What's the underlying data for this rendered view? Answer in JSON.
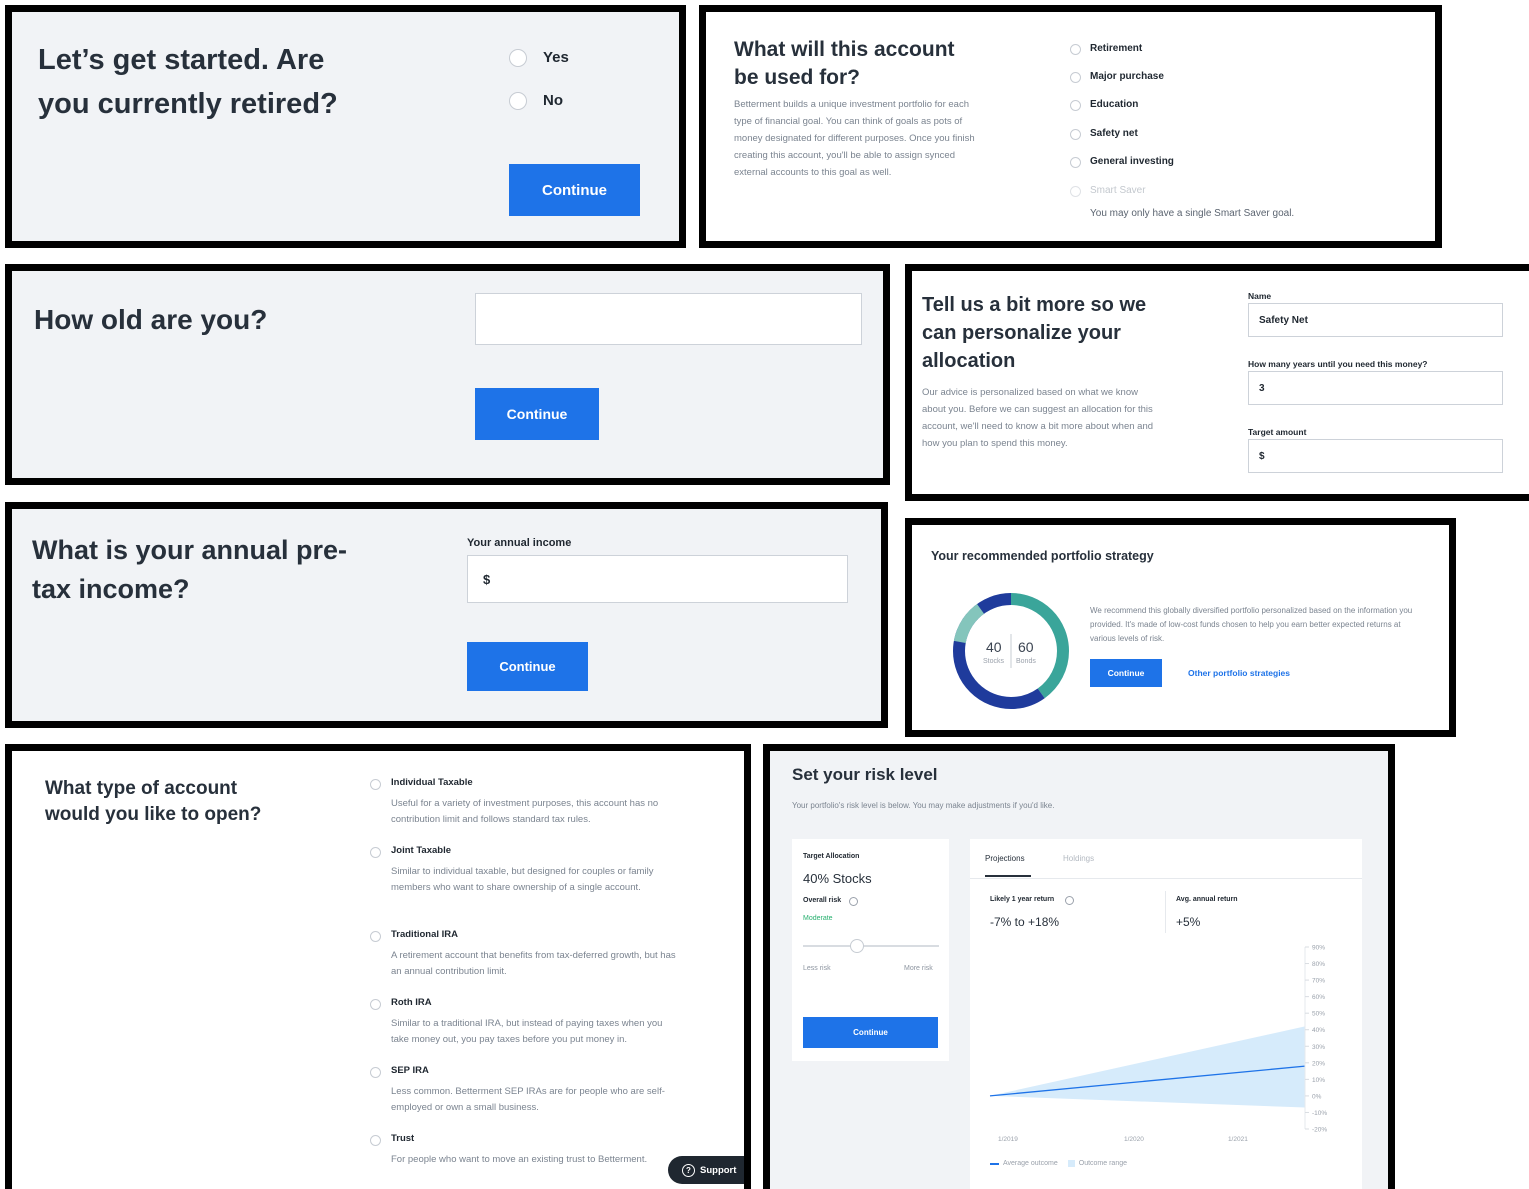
{
  "retired": {
    "title": "Let’s get started. Are you currently retired?",
    "options": [
      "Yes",
      "No"
    ],
    "continue": "Continue"
  },
  "purpose": {
    "title": "What will this account be used for?",
    "desc": "Betterment builds a unique investment portfolio for each type of financial goal. You can think of goals as pots of money designated for different purposes. Once you finish creating this account, you'll be able to assign synced external accounts to this goal as well.",
    "options": [
      "Retirement",
      "Major purchase",
      "Education",
      "Safety net",
      "General investing",
      "Smart Saver"
    ],
    "note": "You may only have a single Smart Saver goal."
  },
  "age": {
    "title": "How old are you?",
    "input_value": "",
    "continue": "Continue"
  },
  "personalize": {
    "title": "Tell us a bit more so we can personalize your allocation",
    "desc": "Our advice is personalized based on what we know about you. Before we can suggest an allocation for this account, we'll need to know a bit more about when and how you plan to spend this money.",
    "name_label": "Name",
    "name_value": "Safety Net",
    "years_label": "How many years until you need this money?",
    "years_value": "3",
    "target_label": "Target amount",
    "target_value": "$"
  },
  "income": {
    "title": "What is your annual pre-tax income?",
    "label": "Your annual income",
    "value": "$",
    "continue": "Continue"
  },
  "strategy": {
    "title": "Your recommended portfolio strategy",
    "stocks_value": "40",
    "stocks_label": "Stocks",
    "bonds_value": "60",
    "bonds_label": "Bonds",
    "desc": "We recommend this globally diversified portfolio personalized based on the information you provided. It's made of low-cost funds chosen to help you earn better expected returns at various levels of risk.",
    "continue": "Continue",
    "other_link": "Other portfolio strategies",
    "colors": {
      "stocks": "#3aa59a",
      "bonds": "#1f3b9c"
    }
  },
  "account_type": {
    "title": "What type of account would you like to open?",
    "options": [
      {
        "label": "Individual Taxable",
        "desc": "Useful for a variety of investment purposes, this account has no contribution limit and follows standard tax rules."
      },
      {
        "label": "Joint Taxable",
        "desc": "Similar to individual taxable, but designed for couples or family members who want to share ownership of a single account."
      },
      {
        "label": "Traditional IRA",
        "desc": "A retirement account that benefits from tax-deferred growth, but has an annual contribution limit."
      },
      {
        "label": "Roth IRA",
        "desc": "Similar to a traditional IRA, but instead of paying taxes when you take money out, you pay taxes before you put money in."
      },
      {
        "label": "SEP IRA",
        "desc": "Less common. Betterment SEP IRAs are for people who are self-employed or own a small business."
      },
      {
        "label": "Trust",
        "desc": "For people who want to move an existing trust to Betterment."
      }
    ],
    "support": "Support"
  },
  "risk": {
    "title": "Set your risk level",
    "subtitle": "Your portfolio's risk level is below. You may make adjustments if you'd like.",
    "target_label": "Target Allocation",
    "target_value": "40% Stocks",
    "overall_risk_label": "Overall risk",
    "overall_risk_value": "Moderate",
    "slider_level": 0.4,
    "less_risk": "Less risk",
    "more_risk": "More risk",
    "continue": "Continue",
    "tabs": [
      "Projections",
      "Holdings"
    ],
    "likely_label": "Likely 1 year return",
    "likely_value": "-7% to +18%",
    "avg_label": "Avg. annual return",
    "avg_value": "+5%",
    "legend": [
      "Average outcome",
      "Outcome range"
    ]
  },
  "chart_data": {
    "type": "area",
    "x": [
      "1/2019",
      "1/2020",
      "1/2021"
    ],
    "y_ticks": [
      "90%",
      "80%",
      "70%",
      "60%",
      "50%",
      "40%",
      "30%",
      "20%",
      "10%",
      "0%",
      "-10%",
      "-20%"
    ],
    "ylim": [
      -20,
      90
    ],
    "series": [
      {
        "name": "Average outcome",
        "points": [
          [
            0,
            0
          ],
          [
            1,
            18
          ]
        ]
      },
      {
        "name": "Outcome range",
        "upper": [
          [
            0,
            0
          ],
          [
            1,
            42
          ]
        ],
        "lower": [
          [
            0,
            0
          ],
          [
            1,
            -7
          ]
        ]
      }
    ],
    "colors": {
      "line": "#1e73e8",
      "band": "#d6ebfb"
    }
  }
}
